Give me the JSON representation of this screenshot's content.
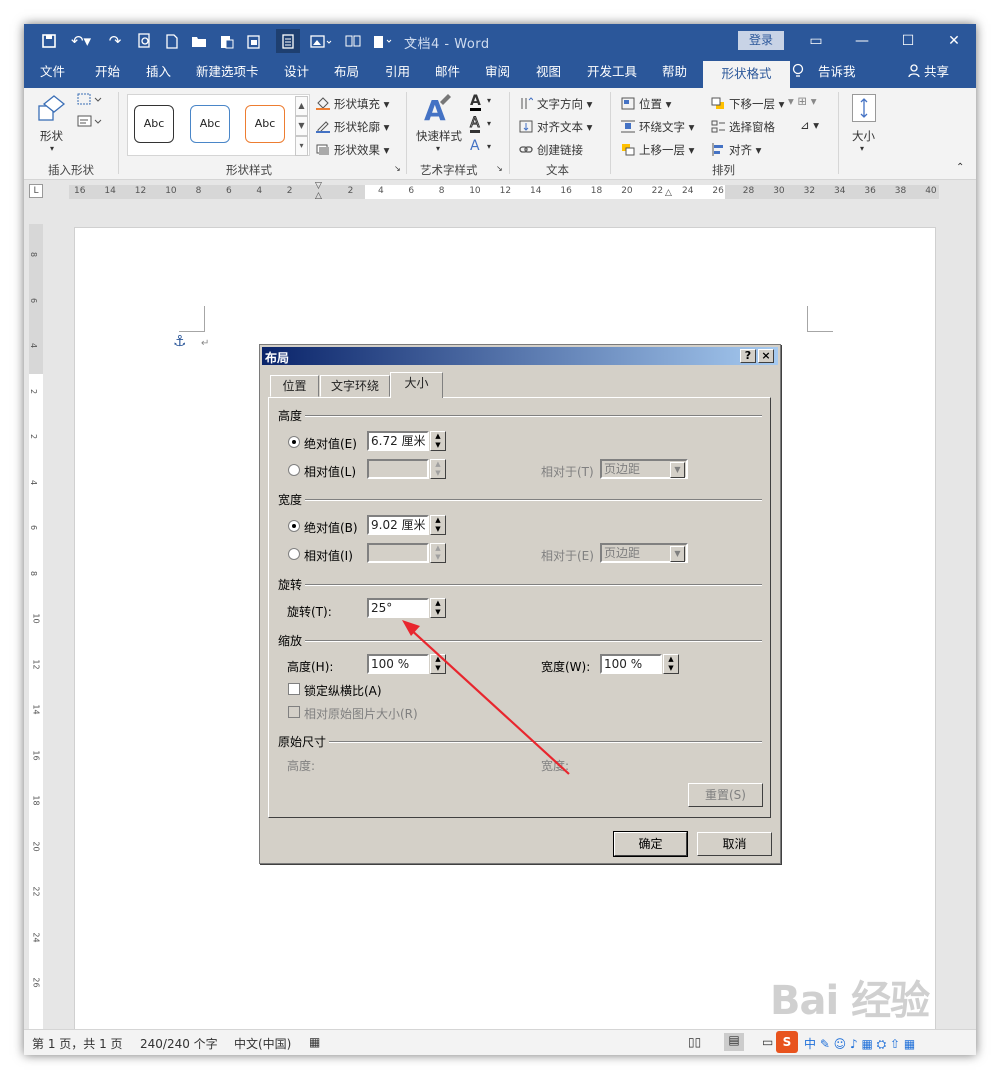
{
  "title_bar": {
    "document_title": "文档4  -  Word",
    "login_label": "登录",
    "quick_access_icons": [
      "save-icon",
      "undo-icon",
      "redo-icon",
      "print-preview-icon",
      "new-doc-icon",
      "open-folder-icon",
      "paste-icon",
      "clipboard-icon",
      "page-view-icon",
      "image-icon",
      "columns-icon",
      "paste-special-icon",
      "customize-icon"
    ],
    "window_controls": {
      "ribbon_display": "▭",
      "minimize": "—",
      "maximize": "☐",
      "close": "✕"
    }
  },
  "menu": {
    "tabs": [
      "文件",
      "开始",
      "插入",
      "新建选项卡",
      "设计",
      "布局",
      "引用",
      "邮件",
      "审阅",
      "视图",
      "开发工具",
      "帮助"
    ],
    "active_tab": "形状格式",
    "tell_me": "告诉我",
    "share": "共享"
  },
  "ribbon": {
    "insert_shapes": {
      "shape_label": "形状",
      "group_label": "插入形状"
    },
    "shape_styles": {
      "style_boxes": [
        "Abc",
        "Abc",
        "Abc"
      ],
      "fill": "形状填充",
      "outline": "形状轮廓",
      "effects": "形状效果",
      "group_label": "形状样式"
    },
    "wordart": {
      "quick_styles": "快速样式",
      "group_label": "艺术字样式"
    },
    "text": {
      "direction": "文字方向",
      "align": "对齐文本",
      "link": "创建链接",
      "group_label": "文本"
    },
    "arrange": {
      "position": "位置",
      "wrap": "环绕文字",
      "bring_forward": "上移一层",
      "send_backward": "下移一层",
      "selection_pane": "选择窗格",
      "align": "对齐",
      "group_label": "排列"
    },
    "size": {
      "label": "大小"
    }
  },
  "ruler": {
    "h_numbers": [
      "16",
      "14",
      "12",
      "10",
      "8",
      "6",
      "4",
      "2",
      "2",
      "4",
      "6",
      "8",
      "10",
      "12",
      "14",
      "16",
      "18",
      "20",
      "22",
      "24",
      "26",
      "28",
      "30",
      "32",
      "34",
      "36",
      "38",
      "40"
    ],
    "v_numbers": [
      "8",
      "6",
      "4",
      "2",
      "2",
      "4",
      "6",
      "8",
      "10",
      "12",
      "14",
      "16",
      "18",
      "20",
      "22",
      "24",
      "26"
    ]
  },
  "dialog": {
    "title": "布局",
    "help": "?",
    "close": "×",
    "tabs": [
      "位置",
      "文字环绕",
      "大小"
    ],
    "height": {
      "section": "高度",
      "absolute_label": "绝对值(E)",
      "absolute_value": "6.72 厘米",
      "relative_label": "相对值(L)",
      "relative_to_label": "相对于(T)",
      "relative_to_value": "页边距"
    },
    "width": {
      "section": "宽度",
      "absolute_label": "绝对值(B)",
      "absolute_value": "9.02 厘米",
      "relative_label": "相对值(I)",
      "relative_to_label": "相对于(E)",
      "relative_to_value": "页边距"
    },
    "rotation": {
      "section": "旋转",
      "label": "旋转(T):",
      "value": "25°"
    },
    "scale": {
      "section": "缩放",
      "height_label": "高度(H):",
      "height_value": "100 %",
      "width_label": "宽度(W):",
      "width_value": "100 %",
      "lock_aspect": "锁定纵横比(A)",
      "relative_original": "相对原始图片大小(R)"
    },
    "original": {
      "section": "原始尺寸",
      "height_label": "高度:",
      "width_label": "宽度:"
    },
    "reset": "重置(S)",
    "ok": "确定",
    "cancel": "取消"
  },
  "status_bar": {
    "page": "第 1 页，共 1 页",
    "words": "240/240 个字",
    "language": "中文(中国)"
  },
  "watermark": "Bai 经验",
  "colors": {
    "word_blue": "#2b579a",
    "annotation_red": "#e8262e",
    "dialog_gray": "#d4d0c8"
  }
}
